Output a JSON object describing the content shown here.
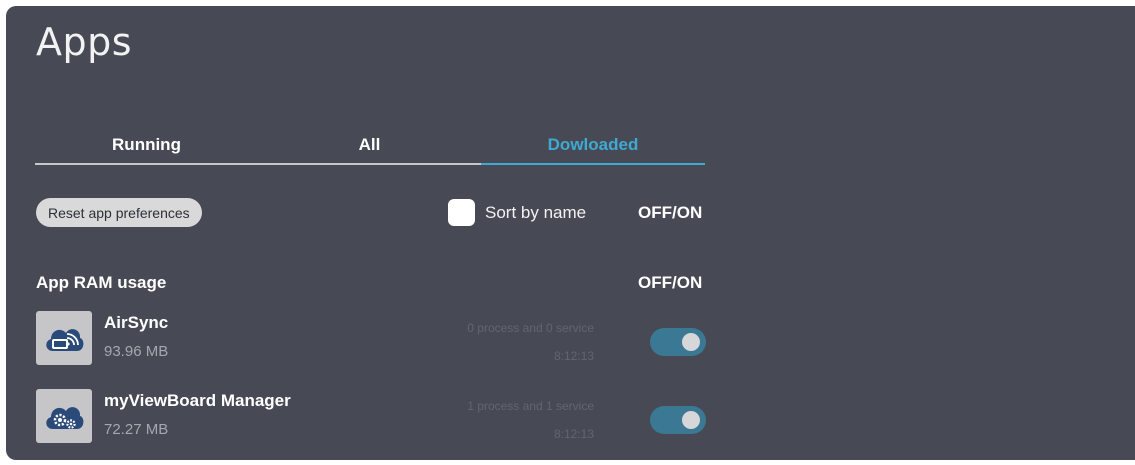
{
  "page": {
    "title": "Apps"
  },
  "tabs": [
    {
      "label": "Running",
      "active": false
    },
    {
      "label": "All",
      "active": false
    },
    {
      "label": "Dowloaded",
      "active": true
    }
  ],
  "controls": {
    "reset_label": "Reset app preferences",
    "sort_label": "Sort by name",
    "sort_checked": false,
    "sort_toggle_label": "OFF/ON"
  },
  "ram_section": {
    "label": "App RAM usage",
    "toggle_label": "OFF/ON"
  },
  "apps": [
    {
      "name": "AirSync",
      "size": "93.96 MB",
      "processes": "0 process and 0 service",
      "time": "8:12:13",
      "enabled": true,
      "icon": "cloud-cast-icon"
    },
    {
      "name": "myViewBoard Manager",
      "size": "72.27 MB",
      "processes": "1 process and 1 service",
      "time": "8:12:13",
      "enabled": true,
      "icon": "cloud-gears-icon"
    }
  ],
  "colors": {
    "panel_bg": "#474a55",
    "accent": "#3fa9d2",
    "toggle_on": "#3b7894",
    "icon_blue": "#2a4a7a"
  }
}
